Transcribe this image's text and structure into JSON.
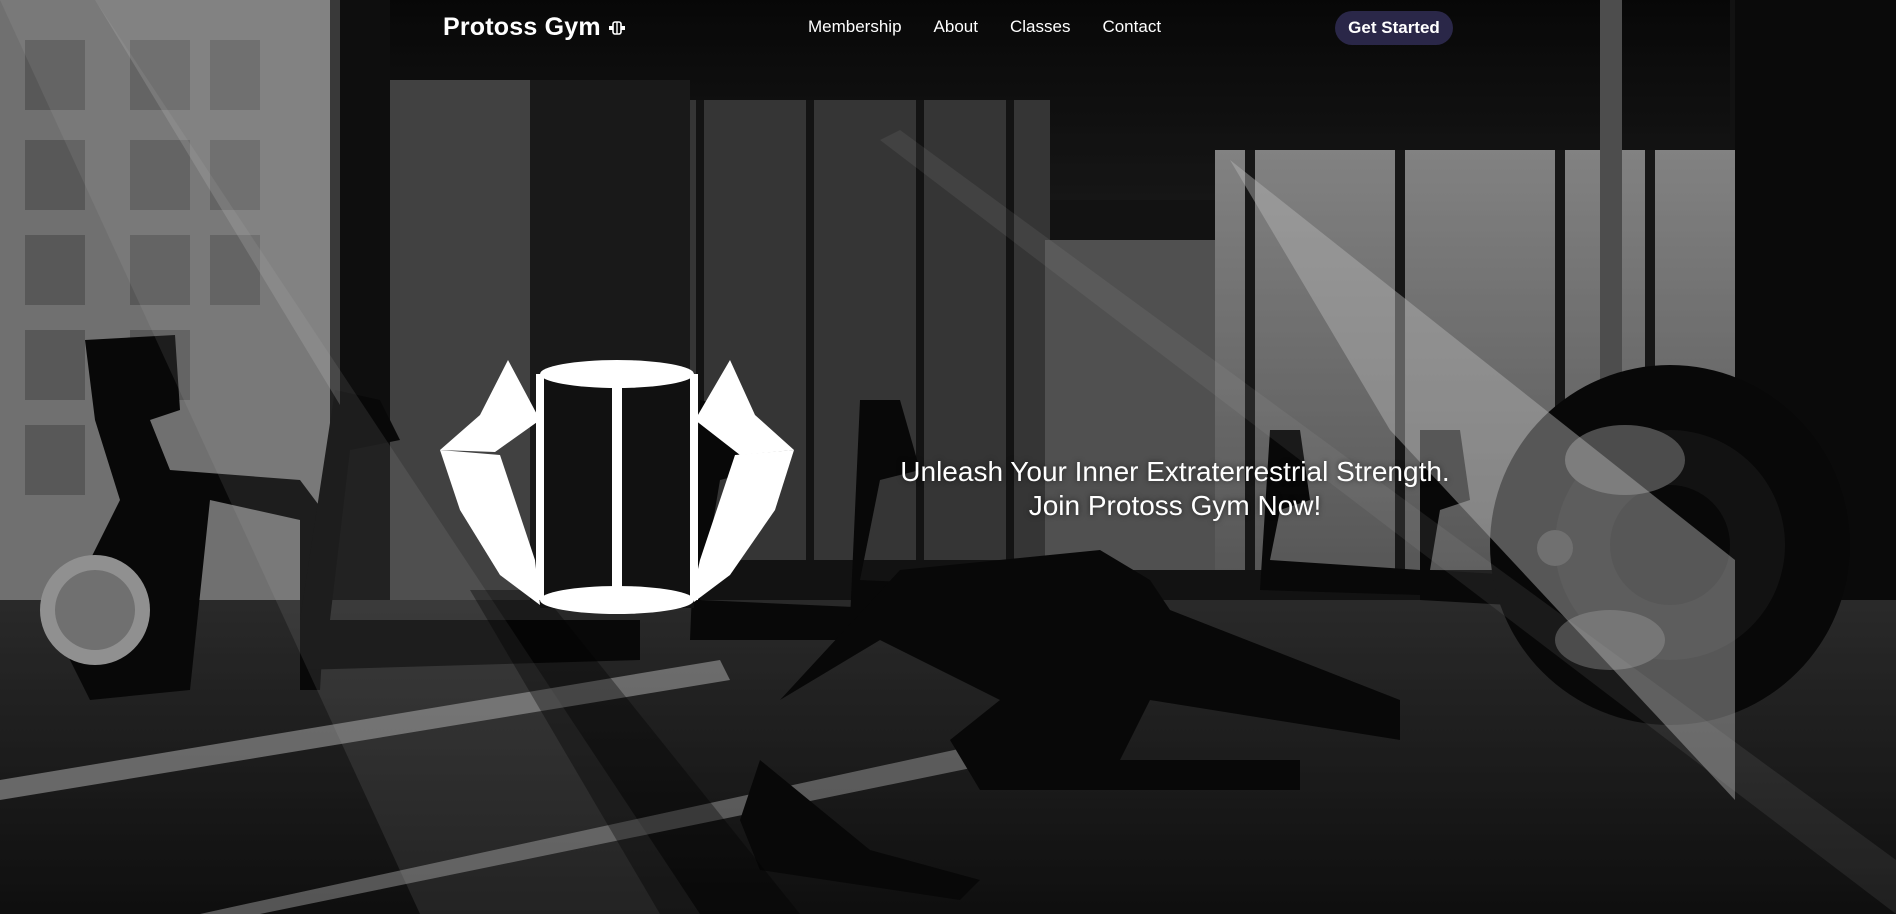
{
  "brand": {
    "name": "Protoss Gym",
    "icon": "dumbbell-icon"
  },
  "nav": {
    "links": [
      "Membership",
      "About",
      "Classes",
      "Contact"
    ]
  },
  "cta": {
    "label": "Get Started",
    "color": "#2a2748"
  },
  "hero": {
    "tagline_line1": "Unleash Your Inner Extraterrestrial Strength.",
    "tagline_line2": "Join Protoss Gym Now!",
    "logo_icon": "protoss-crest-icon",
    "background": "grayscale-gym-interior"
  }
}
